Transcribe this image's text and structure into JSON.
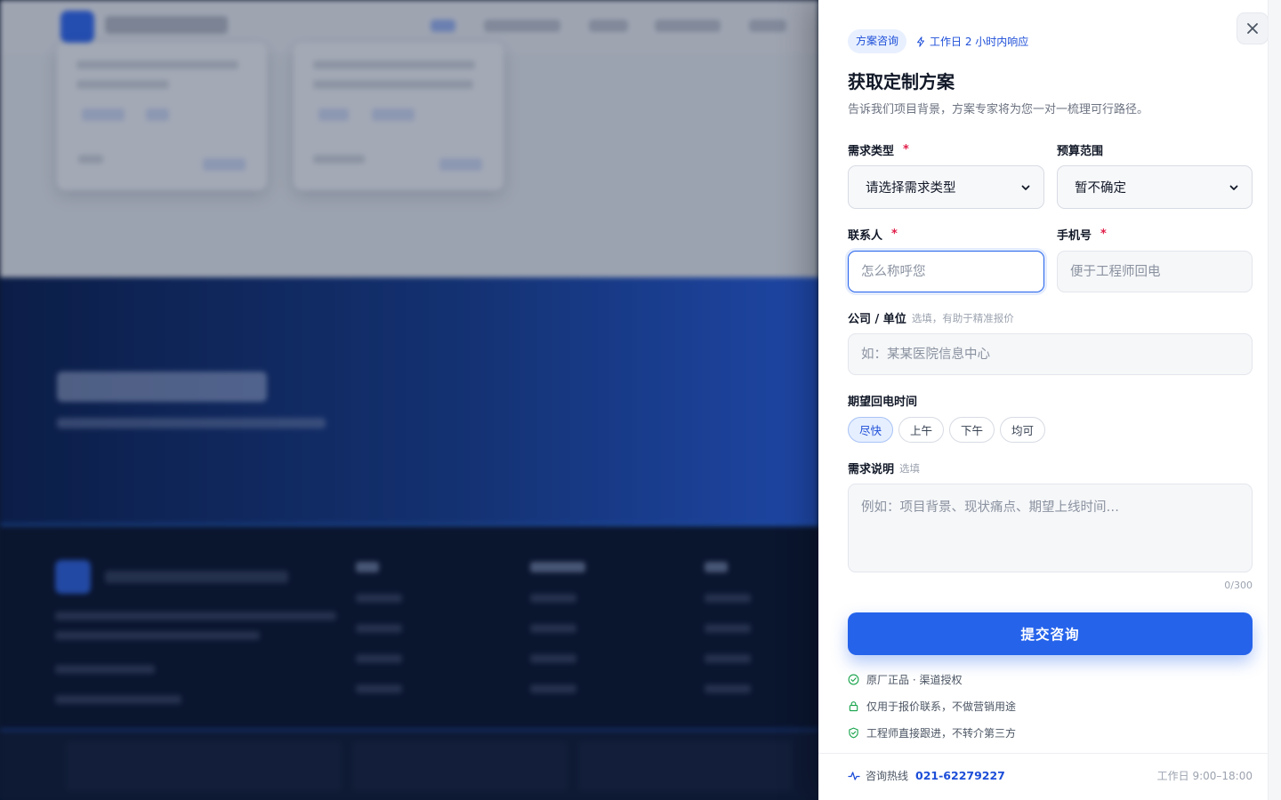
{
  "drawer": {
    "badge": "方案咨询",
    "response_note": "工作日 2 小时内响应",
    "title": "获取定制方案",
    "subtitle": "告诉我们项目背景，方案专家将为您一对一梳理可行路径。",
    "close_icon": "close-icon"
  },
  "form": {
    "demand_type": {
      "label": "需求类型",
      "required_mark": "*",
      "value": "请选择需求类型"
    },
    "budget": {
      "label": "预算范围",
      "value": "暂不确定"
    },
    "contact": {
      "label": "联系人",
      "required_mark": "*",
      "placeholder": "怎么称呼您"
    },
    "phone": {
      "label": "手机号",
      "required_mark": "*",
      "placeholder": "便于工程师回电"
    },
    "company": {
      "label": "公司 / 单位",
      "hint": "选填，有助于精准报价",
      "placeholder": "如：某某医院信息中心"
    },
    "callback": {
      "label": "期望回电时间",
      "options": [
        "尽快",
        "上午",
        "下午",
        "均可"
      ],
      "selected": "尽快"
    },
    "description": {
      "label": "需求说明",
      "hint": "选填",
      "placeholder": "例如：项目背景、现状痛点、期望上线时间…",
      "counter": "0/300"
    },
    "submit_label": "提交咨询"
  },
  "assurances": [
    {
      "icon": "check-circle-icon",
      "text": "原厂正品 · 渠道授权"
    },
    {
      "icon": "lock-icon",
      "text": "仅用于报价联系，不做营销用途"
    },
    {
      "icon": "shield-check-icon",
      "text": "工程师直接跟进，不转介第三方"
    }
  ],
  "footer": {
    "hotline_label": "咨询热线",
    "hotline_number": "021-62279227",
    "hours": "工作日 9:00–18:00"
  },
  "colors": {
    "accent": "#2563eb",
    "accent_light": "#e8f0ff",
    "required": "#e11d48"
  }
}
